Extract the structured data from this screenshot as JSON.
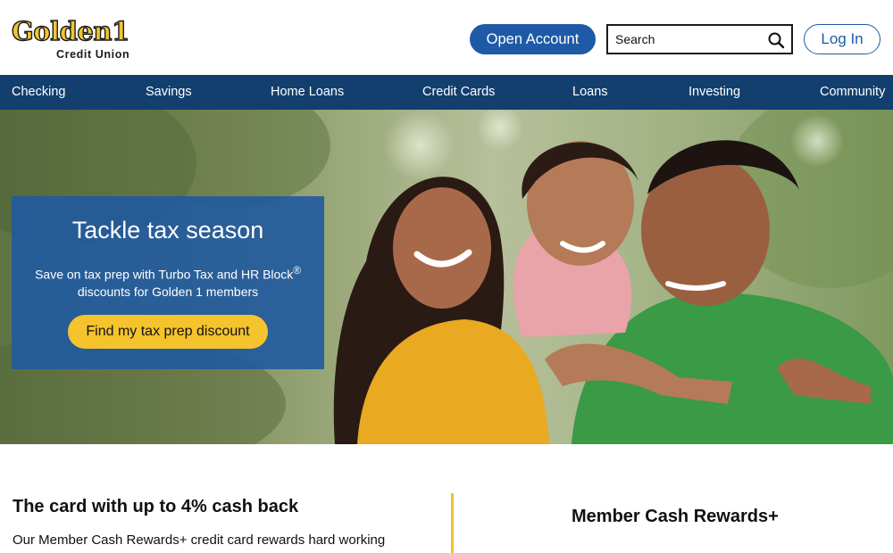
{
  "header": {
    "logo_word": "Golden1",
    "logo_sub": "Credit Union",
    "open_account": "Open Account",
    "search_placeholder": "Search",
    "login": "Log In"
  },
  "nav": {
    "items": [
      "Checking",
      "Savings",
      "Home Loans",
      "Credit Cards",
      "Loans",
      "Investing",
      "Community"
    ]
  },
  "hero": {
    "title": "Tackle tax season",
    "desc_line1": "Save on tax prep with Turbo Tax and HR Block",
    "desc_sup": "®",
    "desc_line2": "discounts for Golden 1 members",
    "cta": "Find my tax prep discount"
  },
  "promo_card": {
    "heading": "The card with up to 4% cash back",
    "desc": "Our Member Cash Rewards+ credit card rewards hard working"
  },
  "rewards": {
    "heading": "Member Cash Rewards+"
  },
  "colors": {
    "brand_blue": "#1f5aa6",
    "nav_navy": "#123f6e",
    "gold": "#f5c32c"
  }
}
